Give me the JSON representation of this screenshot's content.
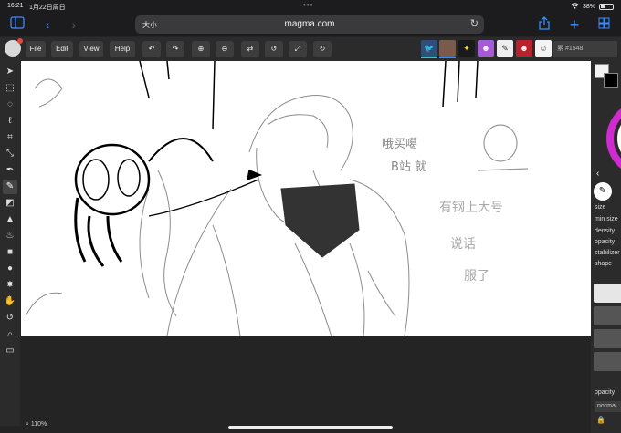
{
  "status_bar": {
    "time": "16:21",
    "date": "1月22日周日",
    "battery": "38%"
  },
  "browser": {
    "text_size_label": "大小",
    "url": "magma.com"
  },
  "app_toolbar": {
    "menus": [
      "File",
      "Edit",
      "View",
      "Help"
    ],
    "room_label": "累 #1548"
  },
  "canvas": {
    "zoom": "110%",
    "annotations": [
      "哦买噶",
      "B站 就",
      "有钢上大号",
      "说话",
      "服了"
    ]
  },
  "right_panel": {
    "labels": [
      "size",
      "min size",
      "density",
      "opacity",
      "stabilizer",
      "shape"
    ],
    "layer_opacity_label": "opacity",
    "blend_mode": "norma",
    "colors": {
      "primary": "#000000",
      "secondary": "#f2f2f2",
      "accent": "#3a8dff"
    }
  }
}
